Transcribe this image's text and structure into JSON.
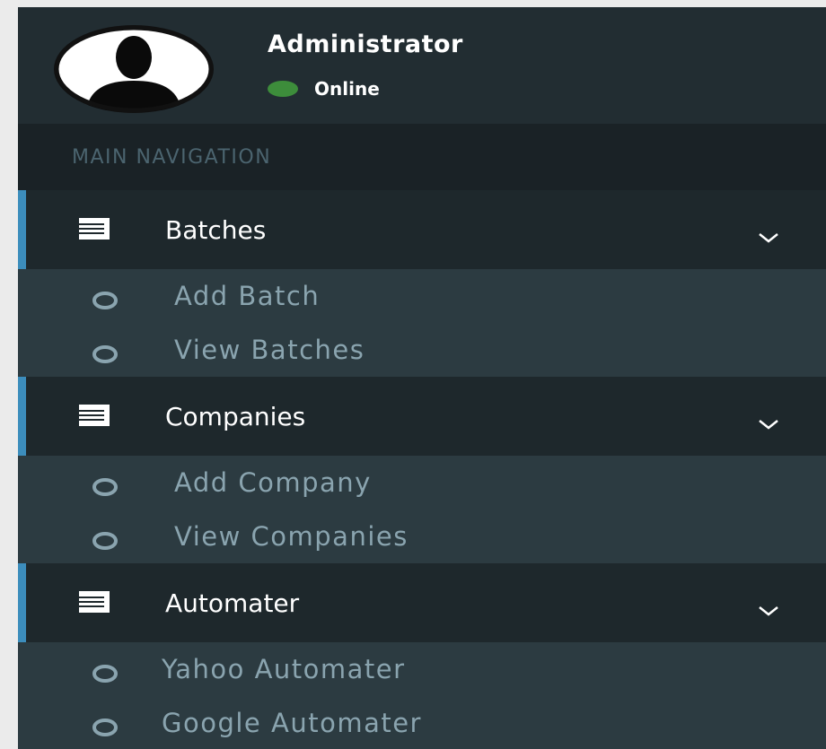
{
  "user": {
    "name": "Administrator",
    "status": "Online",
    "status_color": "#3d8d3b"
  },
  "nav_header": "MAIN NAVIGATION",
  "colors": {
    "sidebar_bg": "#222d32",
    "active_border": "#3c8dbc",
    "submenu_bg": "#2c3b41",
    "submenu_text": "#8aa4af"
  },
  "menu": [
    {
      "label": "Batches",
      "icon": "list-icon",
      "children": [
        "Add Batch",
        "View Batches"
      ]
    },
    {
      "label": "Companies",
      "icon": "list-icon",
      "children": [
        "Add Company",
        "View Companies"
      ]
    },
    {
      "label": "Automater",
      "icon": "list-icon",
      "children": [
        "Yahoo Automater",
        "Google Automater"
      ]
    }
  ]
}
